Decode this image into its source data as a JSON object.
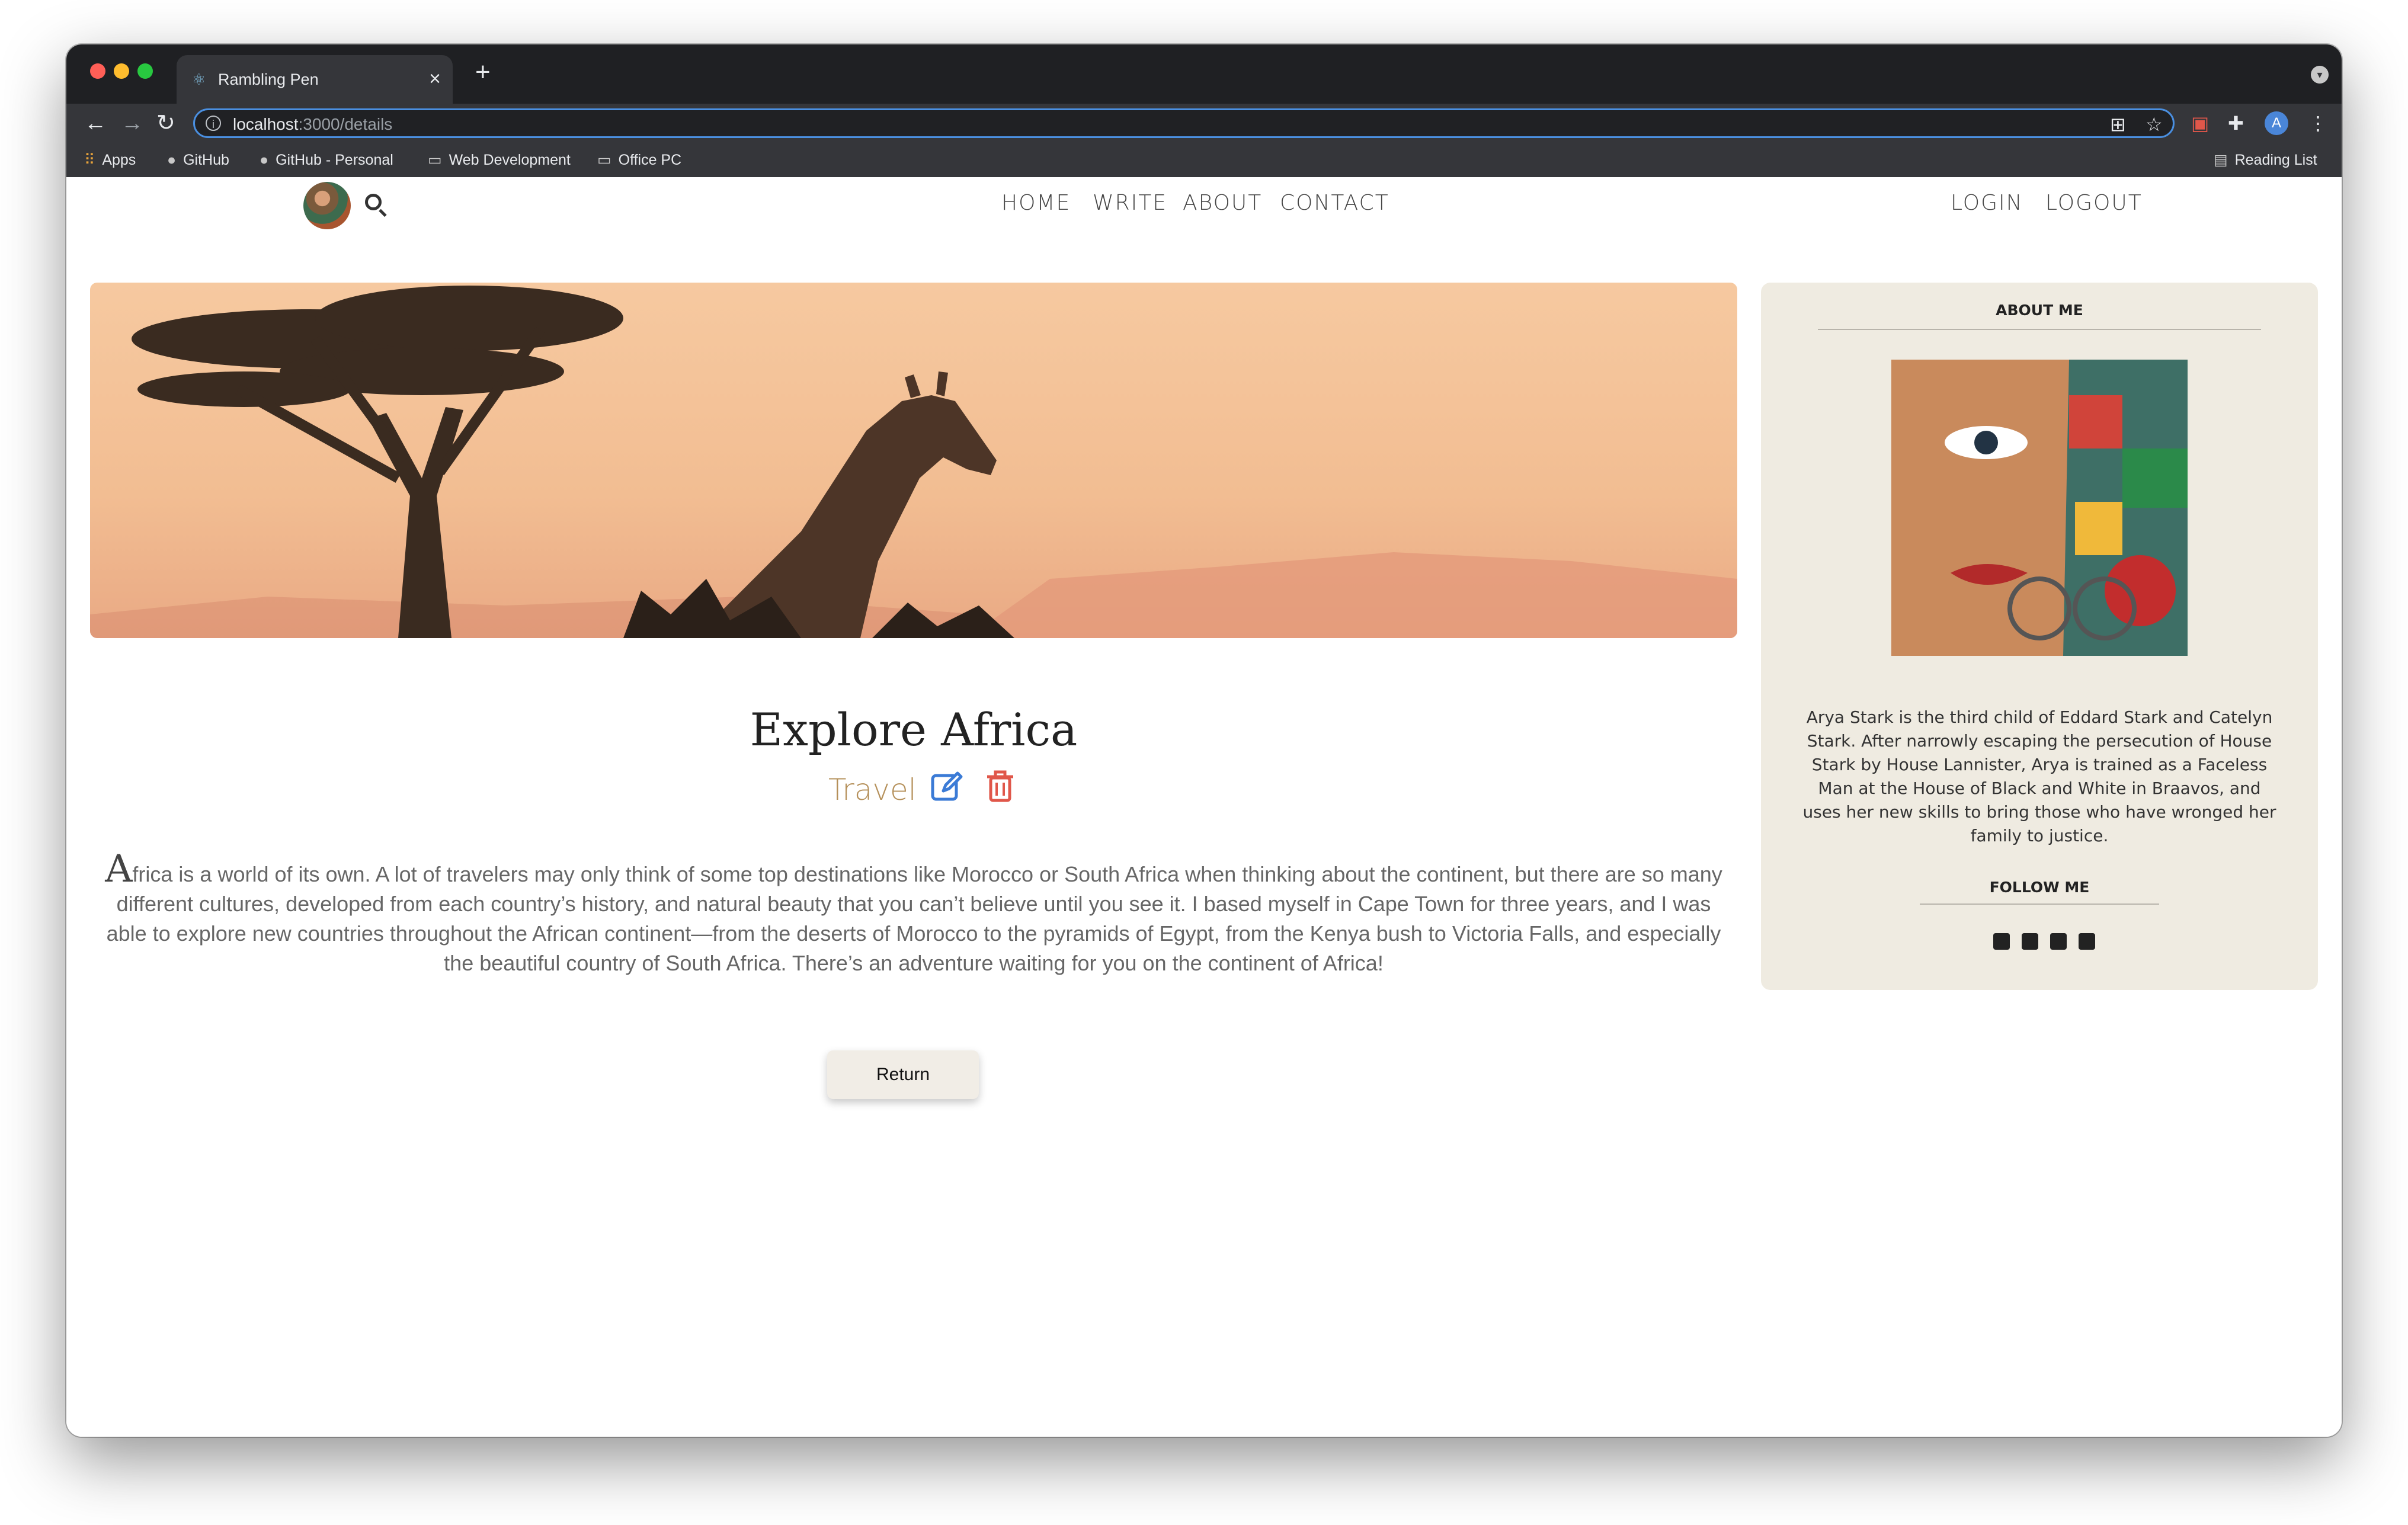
{
  "browser": {
    "tab_title": "Rambling Pen",
    "tab_close": "×",
    "new_tab": "+",
    "url_host": "localhost",
    "url_path": ":3000/details",
    "profile_initial": "A",
    "bookmarks": {
      "apps": "Apps",
      "github": "GitHub",
      "github_personal": "GitHub - Personal",
      "web_development": "Web Development",
      "office_pc": "Office PC",
      "reading_list": "Reading List"
    }
  },
  "nav": {
    "home": "HOME",
    "write": "WRITE",
    "about": "ABOUT",
    "contact": "CONTACT",
    "login": "LOGIN",
    "logout": "LOGOUT"
  },
  "post": {
    "title": "Explore Africa",
    "category": "Travel",
    "body_first_letter": "A",
    "body_rest": "frica is a world of its own. A lot of travelers may only think of some top destinations like Morocco or South Africa when thinking about the continent, but there are so many different cultures, developed from each country’s history, and natural beauty that you can’t believe until you see it. I based myself in Cape Town for three years, and I was able to explore new countries throughout the African continent—from the deserts of Morocco to the pyramids of Egypt, from the Kenya bush to Victoria Falls, and especially the beautiful country of South Africa. There’s an adventure waiting for you on the continent of Africa!",
    "return_label": "Return"
  },
  "sidebar": {
    "about_title": "ABOUT ME",
    "about_text": "Arya Stark is the third child of Eddard Stark and Catelyn Stark. After narrowly escaping the persecution of House Stark by House Lannister, Arya is trained as a Faceless Man at the House of Black and White in Braavos, and uses her new skills to bring those who have wronged her family to justice.",
    "follow_title": "FOLLOW ME",
    "social_icons": [
      "facebook-icon",
      "instagram-icon",
      "pinterest-icon",
      "twitter-icon"
    ]
  },
  "colors": {
    "category": "#b5905a",
    "edit_icon": "#3b7bd6",
    "delete_icon": "#e0574a",
    "sidebar_bg": "#efebe1",
    "hero_sky": "#f4c49a"
  }
}
